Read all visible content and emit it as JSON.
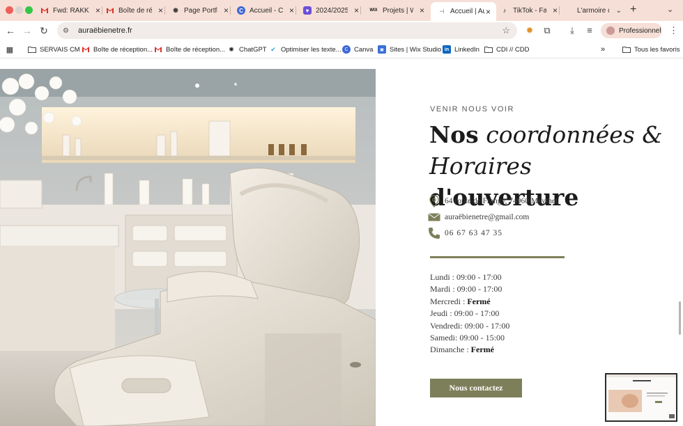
{
  "browser": {
    "tabs": [
      {
        "title": "Fwd: RAKK",
        "icon": "gmail-icon"
      },
      {
        "title": "Boîte de réc",
        "icon": "gmail-icon"
      },
      {
        "title": "Page Portfo",
        "icon": "chatgpt-icon"
      },
      {
        "title": "Accueil - Ca",
        "icon": "canva-icon"
      },
      {
        "title": "2024/2025",
        "icon": "bookmark-icon"
      },
      {
        "title": "Projets | Wi",
        "icon": "wix-icon"
      },
      {
        "title": "Accueil | Au",
        "icon": "page-icon",
        "active": true
      },
      {
        "title": "TikTok - Fai",
        "icon": "tiktok-icon"
      },
      {
        "title": "L'armoire d",
        "icon": "page-icon"
      }
    ],
    "url": "auraëbienetre.fr",
    "profile_label": "Professionnel",
    "bookmarks": [
      {
        "label": "SERVAIS CM",
        "icon": "folder-icon"
      },
      {
        "label": "Boîte de réception...",
        "icon": "gmail-icon"
      },
      {
        "label": "Boîte de réception...",
        "icon": "gmail-icon"
      },
      {
        "label": "ChatGPT",
        "icon": "chatgpt-icon"
      },
      {
        "label": "Optimiser les texte...",
        "icon": "arrow-icon"
      },
      {
        "label": "Canva",
        "icon": "canva-icon"
      },
      {
        "label": "Sites | Wix Studio",
        "icon": "wix-icon"
      },
      {
        "label": "LinkedIn",
        "icon": "linkedin-icon"
      },
      {
        "label": "CDI // CDD",
        "icon": "folder-icon"
      }
    ],
    "all_bookmarks_label": "Tous les favoris"
  },
  "contact": {
    "eyebrow": "VENIR NOUS VOIR",
    "headline": {
      "part1": "Nos",
      "part2": "coordonnées &",
      "part3": "Horaires",
      "part4": "d'ouverture"
    },
    "address": "64 route de Frangy, 74960 Meythet",
    "email": "auraëbienetre@gmail.com",
    "phone": "06 67 63 47 35",
    "hours": [
      {
        "day": "Lundi :",
        "time": "09:00 - 17:00",
        "closed": false
      },
      {
        "day": "Mardi :",
        "time": "09:00 - 17:00",
        "closed": false
      },
      {
        "day": "Mercredi :",
        "time": "Fermé",
        "closed": true
      },
      {
        "day": "Jeudi :",
        "time": "09:00 - 17:00",
        "closed": false
      },
      {
        "day": "Vendredi:",
        "time": "09:00 - 17:00",
        "closed": false
      },
      {
        "day": "Samedi:",
        "time": "09:00 - 15:00",
        "closed": false
      },
      {
        "day": "Dimanche :",
        "time": "Fermé",
        "closed": true
      }
    ],
    "cta_label": "Nous contactez"
  },
  "colors": {
    "accent_olive": "#7d7f5a",
    "tabbar": "#f6dfd6",
    "text_dark": "#1b1b1b"
  }
}
